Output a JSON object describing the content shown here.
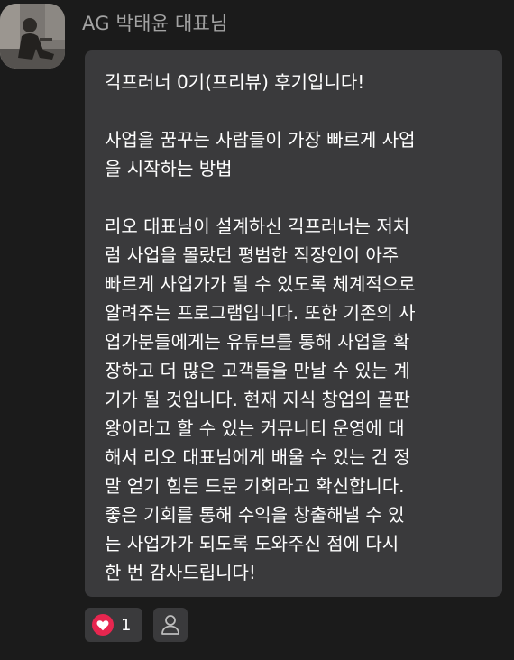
{
  "author": {
    "name": "AG 박태윤 대표님"
  },
  "message": {
    "paragraphs": [
      "긱프러너 0기(프리뷰) 후기입니다!",
      "사업을 꿈꾸는 사람들이 가장 빠르게 사업\n을 시작하는 방법",
      "리오 대표님이 설계하신 긱프러너는 저처\n럼 사업을 몰랐던 평범한 직장인이 아주\n빠르게 사업가가 될 수 있도록 체계적으로\n알려주는 프로그램입니다. 또한 기존의 사\n업가분들에게는 유튜브를 통해 사업을 확\n장하고 더 많은 고객들을 만날 수 있는 계\n기가 될 것입니다. 현재 지식 창업의 끝판\n왕이라고 할 수 있는 커뮤니티 운영에 대\n해서 리오 대표님에게 배울 수 있는 건 정\n말 얻기 힘든 드문 기회라고 확신합니다.\n좋은 기회를 통해 수익을 창출해낼 수 있\n는 사업가가 되도록 도와주신 점에 다시\n한 번 감사드립니다!"
    ]
  },
  "reactions": {
    "like_count": "1",
    "like_icon": "heart-icon",
    "user_icon": "person-icon"
  },
  "colors": {
    "background": "#1b1b1b",
    "bubble": "#3a3a3c",
    "heart": "#e7264f",
    "author_text": "#a3a3a3"
  }
}
